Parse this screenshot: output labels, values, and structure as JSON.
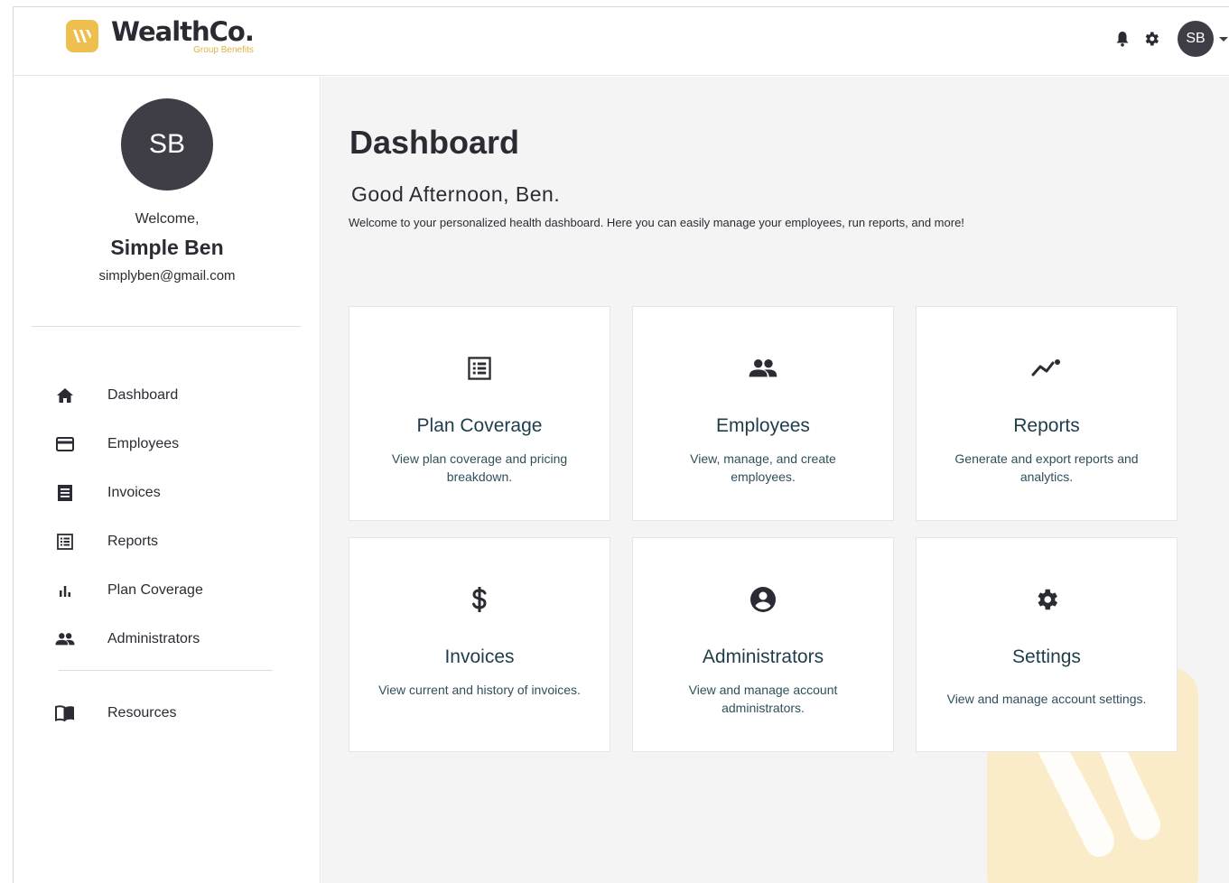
{
  "brand": {
    "name": "WealthCo.",
    "tagline": "Group Benefits",
    "accent_color": "#eebf4f"
  },
  "topbar": {
    "notification_icon": "bell-icon",
    "settings_icon": "gear-icon",
    "avatar_initials": "SB"
  },
  "sidebar": {
    "avatar_initials": "SB",
    "welcome": "Welcome,",
    "user_name": "Simple Ben",
    "user_email": "simplyben@gmail.com",
    "items": [
      {
        "label": "Dashboard",
        "icon": "home-icon"
      },
      {
        "label": "Employees",
        "icon": "card-icon"
      },
      {
        "label": "Invoices",
        "icon": "receipt-icon"
      },
      {
        "label": "Reports",
        "icon": "list-icon"
      },
      {
        "label": "Plan Coverage",
        "icon": "bar-chart-icon"
      },
      {
        "label": "Administrators",
        "icon": "people-icon"
      }
    ],
    "resources": {
      "label": "Resources",
      "icon": "book-icon"
    }
  },
  "main": {
    "title": "Dashboard",
    "greeting": "Good Afternoon, Ben.",
    "intro": "Welcome to your personalized health dashboard. Here you can easily manage your employees, run reports, and more!",
    "cards": [
      {
        "title": "Plan Coverage",
        "description": "View plan coverage and pricing breakdown.",
        "icon": "list-icon"
      },
      {
        "title": "Employees",
        "description": "View, manage, and create employees.",
        "icon": "people-icon"
      },
      {
        "title": "Reports",
        "description": "Generate and export reports and analytics.",
        "icon": "trend-icon"
      },
      {
        "title": "Invoices",
        "description": "View current and history of invoices.",
        "icon": "dollar-icon"
      },
      {
        "title": "Administrators",
        "description": "View and manage account administrators.",
        "icon": "account-circle-icon"
      },
      {
        "title": "Settings",
        "description": "View and manage account settings.",
        "icon": "gear-icon"
      }
    ]
  }
}
